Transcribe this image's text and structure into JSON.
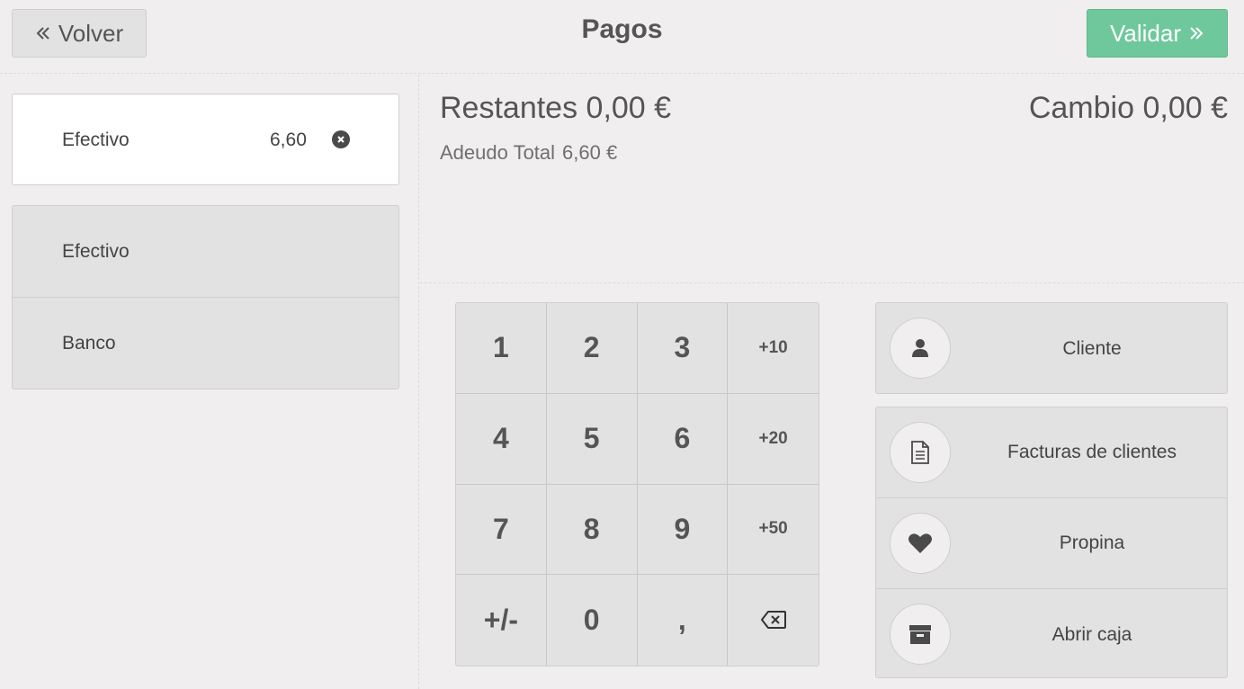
{
  "header": {
    "back_label": "Volver",
    "title": "Pagos",
    "validate_label": "Validar"
  },
  "paymentlines": [
    {
      "name": "Efectivo",
      "amount": "6,60"
    }
  ],
  "payment_methods": [
    {
      "label": "Efectivo"
    },
    {
      "label": "Banco"
    }
  ],
  "summary": {
    "remaining_label": "Restantes",
    "remaining_value": "0,00 €",
    "change_label": "Cambio",
    "change_value": "0,00 €",
    "due_label": "Adeudo Total",
    "due_value": "6,60 €"
  },
  "numpad": {
    "keys": [
      "1",
      "2",
      "3",
      "+10",
      "4",
      "5",
      "6",
      "+20",
      "7",
      "8",
      "9",
      "+50",
      "+/-",
      "0",
      ",",
      "backspace"
    ]
  },
  "actions": {
    "customer": {
      "label": "Cliente",
      "icon": "user-icon"
    },
    "invoice": {
      "label": "Facturas de clientes",
      "icon": "file-icon"
    },
    "tip": {
      "label": "Propina",
      "icon": "heart-icon"
    },
    "cashbox": {
      "label": "Abrir caja",
      "icon": "archive-icon"
    }
  },
  "colors": {
    "background": "#f0eeee",
    "validate": "#6ec89b",
    "button": "#e2e2e2"
  }
}
